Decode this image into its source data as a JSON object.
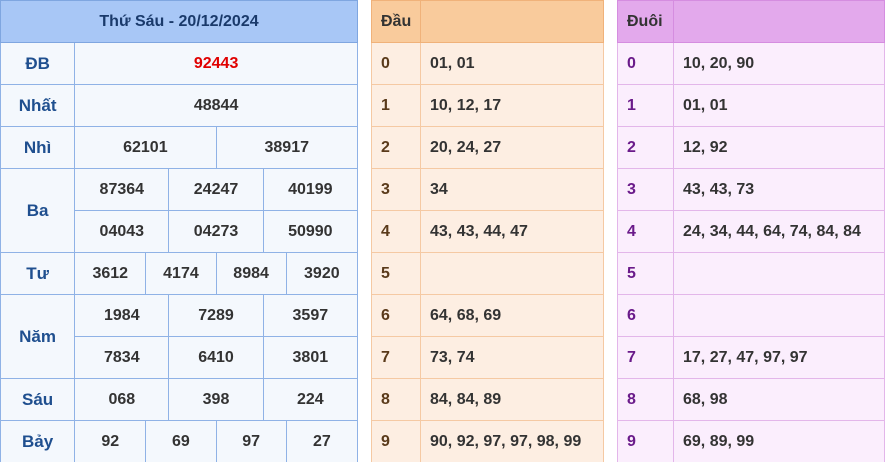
{
  "results": {
    "title": "Thứ Sáu - 20/12/2024",
    "prizes": {
      "db": {
        "label": "ĐB",
        "numbers": [
          "92443"
        ]
      },
      "nhat": {
        "label": "Nhất",
        "numbers": [
          "48844"
        ]
      },
      "nhi": {
        "label": "Nhì",
        "numbers": [
          "62101",
          "38917"
        ]
      },
      "ba": {
        "label": "Ba",
        "numbers": [
          "87364",
          "24247",
          "40199",
          "04043",
          "04273",
          "50990"
        ]
      },
      "tu": {
        "label": "Tư",
        "numbers": [
          "3612",
          "4174",
          "8984",
          "3920"
        ]
      },
      "nam": {
        "label": "Năm",
        "numbers": [
          "1984",
          "7289",
          "3597",
          "7834",
          "6410",
          "3801"
        ]
      },
      "sau": {
        "label": "Sáu",
        "numbers": [
          "068",
          "398",
          "224"
        ]
      },
      "bay": {
        "label": "Bảy",
        "numbers": [
          "92",
          "69",
          "97",
          "27"
        ]
      }
    },
    "colors": {
      "header": "#a8c7f6",
      "special": "#e00000",
      "prize_label": "#1f4f8f"
    }
  },
  "dau": {
    "header": "Đầu",
    "rows": [
      {
        "digit": "0",
        "values": "01, 01"
      },
      {
        "digit": "1",
        "values": "10, 12, 17"
      },
      {
        "digit": "2",
        "values": "20, 24, 27"
      },
      {
        "digit": "3",
        "values": "34"
      },
      {
        "digit": "4",
        "values": "43, 43, 44, 47"
      },
      {
        "digit": "5",
        "values": ""
      },
      {
        "digit": "6",
        "values": "64, 68, 69"
      },
      {
        "digit": "7",
        "values": "73, 74"
      },
      {
        "digit": "8",
        "values": "84, 84, 89"
      },
      {
        "digit": "9",
        "values": "90, 92, 97, 97, 98, 99"
      }
    ],
    "colors": {
      "header": "#f9cb9c",
      "cell": "#fdeee2"
    }
  },
  "duoi": {
    "header": "Đuôi",
    "rows": [
      {
        "digit": "0",
        "values": "10, 20, 90"
      },
      {
        "digit": "1",
        "values": "01, 01"
      },
      {
        "digit": "2",
        "values": "12, 92"
      },
      {
        "digit": "3",
        "values": "43, 43, 73"
      },
      {
        "digit": "4",
        "values": "24, 34, 44, 64, 74, 84, 84"
      },
      {
        "digit": "5",
        "values": ""
      },
      {
        "digit": "6",
        "values": ""
      },
      {
        "digit": "7",
        "values": "17, 27, 47, 97, 97"
      },
      {
        "digit": "8",
        "values": "68, 98"
      },
      {
        "digit": "9",
        "values": "69, 89, 99"
      }
    ],
    "colors": {
      "header": "#e3a9ec",
      "cell": "#fbeefd"
    }
  }
}
